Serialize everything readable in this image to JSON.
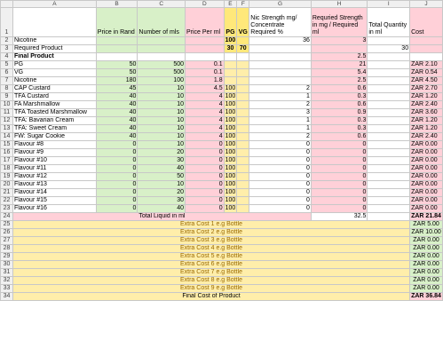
{
  "columns": [
    "A",
    "B",
    "C",
    "D",
    "E",
    "F",
    "G",
    "H",
    "I",
    "J"
  ],
  "headers": {
    "price_rand": "Price in Rand",
    "num_mls": "Number of mls",
    "price_ml": "Price Per ml",
    "pg": "PG",
    "vg": "VG",
    "nic_strength": "Nic Strength mg/ Concentrate Required %",
    "req_strength": "Requried Strength in mg / Required ml",
    "total_qty": "Total Quantity in ml",
    "cost": "Cost"
  },
  "rows_top": [
    {
      "n": "2",
      "a": "Nicotine",
      "e": "100",
      "f": "",
      "g": "36",
      "h": "3",
      "i": ""
    },
    {
      "n": "3",
      "a": "Required Product",
      "e": "30",
      "f": "70",
      "g": "",
      "h": "",
      "i": "30"
    },
    {
      "n": "4",
      "a": "Final Product",
      "h": "2.5"
    }
  ],
  "ingredients": [
    {
      "n": "5",
      "a": "PG",
      "b": "50",
      "c": "500",
      "d": "0.1",
      "e": "",
      "g": "",
      "h": "21",
      "j": "ZAR 2.10"
    },
    {
      "n": "6",
      "a": "VG",
      "b": "50",
      "c": "500",
      "d": "0.1",
      "e": "",
      "g": "",
      "h": "5.4",
      "j": "ZAR 0.54"
    },
    {
      "n": "7",
      "a": "Nicotine",
      "b": "180",
      "c": "100",
      "d": "1.8",
      "e": "",
      "g": "",
      "h": "2.5",
      "j": "ZAR 4.50"
    },
    {
      "n": "8",
      "a": "CAP Custard",
      "b": "45",
      "c": "10",
      "d": "4.5",
      "e": "100",
      "g": "2",
      "h": "0.6",
      "j": "ZAR 2.70"
    },
    {
      "n": "9",
      "a": "TFA Custard",
      "b": "40",
      "c": "10",
      "d": "4",
      "e": "100",
      "g": "1",
      "h": "0.3",
      "j": "ZAR 1.20"
    },
    {
      "n": "10",
      "a": "FA Marshmallow",
      "b": "40",
      "c": "10",
      "d": "4",
      "e": "100",
      "g": "2",
      "h": "0.6",
      "j": "ZAR 2.40"
    },
    {
      "n": "11",
      "a": "TFA Toasted Marshmallow",
      "b": "40",
      "c": "10",
      "d": "4",
      "e": "100",
      "g": "3",
      "h": "0.9",
      "j": "ZAR 3.60"
    },
    {
      "n": "12",
      "a": "TFA: Bavarian Cream",
      "b": "40",
      "c": "10",
      "d": "4",
      "e": "100",
      "g": "1",
      "h": "0.3",
      "j": "ZAR 1.20"
    },
    {
      "n": "13",
      "a": "TFA: Sweet Cream",
      "b": "40",
      "c": "10",
      "d": "4",
      "e": "100",
      "g": "1",
      "h": "0.3",
      "j": "ZAR 1.20"
    },
    {
      "n": "14",
      "a": "FW: Sugar Cookie",
      "b": "40",
      "c": "10",
      "d": "4",
      "e": "100",
      "g": "2",
      "h": "0.6",
      "j": "ZAR 2.40"
    },
    {
      "n": "15",
      "a": "Flavour #8",
      "b": "0",
      "c": "10",
      "d": "0",
      "e": "100",
      "g": "0",
      "h": "0",
      "j": "ZAR 0.00"
    },
    {
      "n": "16",
      "a": "Flavour #9",
      "b": "0",
      "c": "20",
      "d": "0",
      "e": "100",
      "g": "0",
      "h": "0",
      "j": "ZAR 0.00"
    },
    {
      "n": "17",
      "a": "Flavour #10",
      "b": "0",
      "c": "30",
      "d": "0",
      "e": "100",
      "g": "0",
      "h": "0",
      "j": "ZAR 0.00"
    },
    {
      "n": "18",
      "a": "Flavour #11",
      "b": "0",
      "c": "40",
      "d": "0",
      "e": "100",
      "g": "0",
      "h": "0",
      "j": "ZAR 0.00"
    },
    {
      "n": "19",
      "a": "Flavour #12",
      "b": "0",
      "c": "50",
      "d": "0",
      "e": "100",
      "g": "0",
      "h": "0",
      "j": "ZAR 0.00"
    },
    {
      "n": "20",
      "a": "Flavour #13",
      "b": "0",
      "c": "10",
      "d": "0",
      "e": "100",
      "g": "0",
      "h": "0",
      "j": "ZAR 0.00"
    },
    {
      "n": "21",
      "a": "Flavour #14",
      "b": "0",
      "c": "20",
      "d": "0",
      "e": "100",
      "g": "0",
      "h": "0",
      "j": "ZAR 0.00"
    },
    {
      "n": "22",
      "a": "Flavour #15",
      "b": "0",
      "c": "30",
      "d": "0",
      "e": "100",
      "g": "0",
      "h": "0",
      "j": "ZAR 0.00"
    },
    {
      "n": "23",
      "a": "Flavour #16",
      "b": "0",
      "c": "40",
      "d": "0",
      "e": "100",
      "g": "0",
      "h": "0",
      "j": "ZAR 0.00"
    }
  ],
  "total_liquid": {
    "n": "24",
    "label": "Total Liquid in ml",
    "h": "32.5",
    "j": "ZAR 21.84"
  },
  "extras": [
    {
      "n": "25",
      "label": "Extra Cost 1 e.g Bottle",
      "j": "ZAR 5.00"
    },
    {
      "n": "26",
      "label": "Extra Cost 2 e.g Bottle",
      "j": "ZAR 10.00"
    },
    {
      "n": "27",
      "label": "Extra Cost 3 e.g Bottle",
      "j": "ZAR 0.00"
    },
    {
      "n": "28",
      "label": "Extra Cost 4 e.g Bottle",
      "j": "ZAR 0.00"
    },
    {
      "n": "29",
      "label": "Extra Cost 5 e.g Bottle",
      "j": "ZAR 0.00"
    },
    {
      "n": "30",
      "label": "Extra Cost 6 e.g Bottle",
      "j": "ZAR 0.00"
    },
    {
      "n": "31",
      "label": "Extra Cost 7 e.g Bottle",
      "j": "ZAR 0.00"
    },
    {
      "n": "32",
      "label": "Extra Cost 8 e.g Bottle",
      "j": "ZAR 0.00"
    },
    {
      "n": "33",
      "label": "Extra Cost 9 e.g Bottle",
      "j": "ZAR 0.00"
    }
  ],
  "final_cost": {
    "n": "34",
    "label": "Final Cost of Product",
    "j": "ZAR 36.84"
  },
  "colors": {
    "green": "#d8f0c8",
    "pink": "#ffd0d8",
    "yellow": "#ffeeaa"
  }
}
